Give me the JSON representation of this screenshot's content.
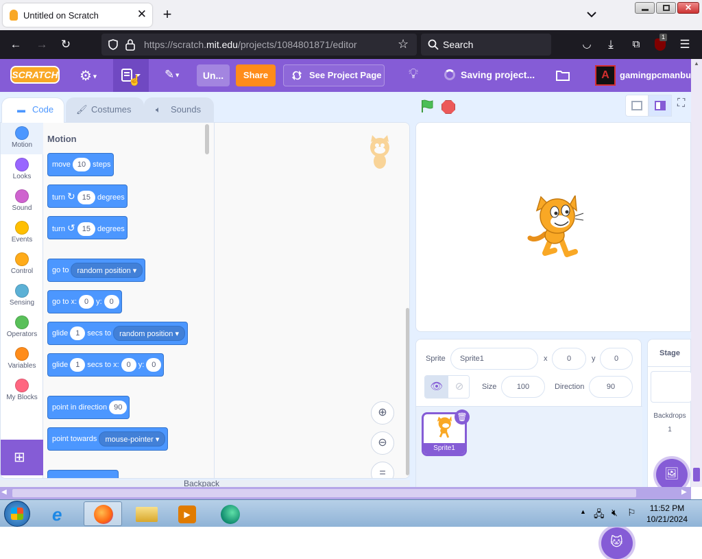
{
  "browser": {
    "tab_title": "Untitled on Scratch",
    "url_host": "https://scratch.",
    "url_domain": "mit.edu",
    "url_path": "/projects/1084801871/editor",
    "search_placeholder": "Search",
    "extension_badge": "1"
  },
  "menubar": {
    "logo": "SCRATCH",
    "project_title": "Un...",
    "share": "Share",
    "see_project_page": "See Project Page",
    "saving_status": "Saving project...",
    "username": "gamingpcmanbutg",
    "avatar_letter": "A",
    "color": "#855cd6"
  },
  "editor_tabs": [
    "Code",
    "Costumes",
    "Sounds"
  ],
  "categories": [
    {
      "label": "Motion",
      "color": "#4c97ff"
    },
    {
      "label": "Looks",
      "color": "#9966ff"
    },
    {
      "label": "Sound",
      "color": "#cf63cf"
    },
    {
      "label": "Events",
      "color": "#ffbf00"
    },
    {
      "label": "Control",
      "color": "#ffab19"
    },
    {
      "label": "Sensing",
      "color": "#5cb1d6"
    },
    {
      "label": "Operators",
      "color": "#59c059"
    },
    {
      "label": "Variables",
      "color": "#ff8c1a"
    },
    {
      "label": "My Blocks",
      "color": "#ff6680"
    }
  ],
  "palette": {
    "header": "Motion",
    "blocks": {
      "move": {
        "a": "move",
        "v1": "10",
        "b": "steps"
      },
      "turn_right": {
        "a": "turn",
        "v1": "15",
        "b": "degrees"
      },
      "turn_left": {
        "a": "turn",
        "v1": "15",
        "b": "degrees"
      },
      "goto": {
        "a": "go to",
        "dd": "random position"
      },
      "goto_xy": {
        "a": "go to x:",
        "v1": "0",
        "b": "y:",
        "v2": "0"
      },
      "glide": {
        "a": "glide",
        "v1": "1",
        "b": "secs to",
        "dd": "random position"
      },
      "glide_xy": {
        "a": "glide",
        "v1": "1",
        "b": "secs to x:",
        "v2": "0",
        "c": "y:",
        "v3": "0"
      },
      "point_dir": {
        "a": "point in direction",
        "v1": "90"
      },
      "point_towards": {
        "a": "point towards",
        "dd": "mouse-pointer"
      }
    }
  },
  "backpack": "Backpack",
  "sprite_info": {
    "sprite_label": "Sprite",
    "sprite_name": "Sprite1",
    "x_label": "x",
    "x": "0",
    "y_label": "y",
    "y": "0",
    "size_label": "Size",
    "size": "100",
    "direction_label": "Direction",
    "direction": "90"
  },
  "sprite_thumb": "Sprite1",
  "stage_panel": {
    "title": "Stage",
    "backdrops_label": "Backdrops",
    "backdrops_count": "1"
  },
  "taskbar": {
    "time": "11:52 PM",
    "date": "10/21/2024"
  }
}
